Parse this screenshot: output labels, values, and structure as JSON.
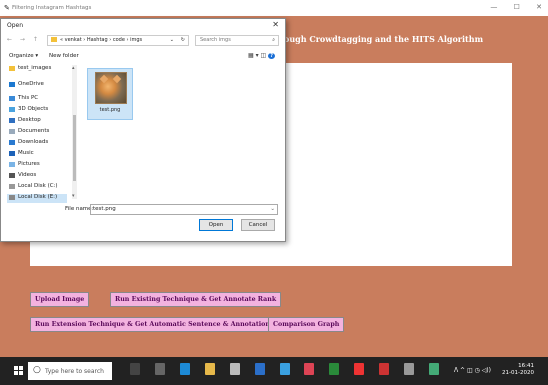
{
  "app": {
    "title": "Filtering Instagram Hashtags",
    "heading": "ough Crowdtagging and the HITS Algorithm",
    "controls": {
      "minimize": "—",
      "maximize": "☐",
      "close": "✕"
    }
  },
  "buttons": {
    "upload": "Upload Image",
    "existing": "Run Existing Technique & Get Annotate Rank",
    "extension": "Run Extension Technique & Get Automatic Sentence & Annotation",
    "comparison": "Comparison Graph"
  },
  "dialog": {
    "title": "Open",
    "close_glyph": "✕",
    "nav_arrows": "← → ↑",
    "path": "« venkat › Hashtag › code › imgs",
    "path_dropdown": "⌄",
    "refresh_glyph": "↻",
    "search_placeholder": "Search imgs",
    "search_glyph": "⌕",
    "toolbar": {
      "organize": "Organize ▾",
      "new_folder": "New folder",
      "view_glyph": "▦ ▾ ◫"
    },
    "help_glyph": "?",
    "sidebar": [
      {
        "label": "test_images",
        "color": "#f3c13a"
      },
      {
        "label": "OneDrive",
        "color": "#1b78d0"
      },
      {
        "label": "This PC",
        "color": "#3a8ad8"
      },
      {
        "label": "3D Objects",
        "color": "#4aa3df"
      },
      {
        "label": "Desktop",
        "color": "#2f6fc0"
      },
      {
        "label": "Documents",
        "color": "#9ab"
      },
      {
        "label": "Downloads",
        "color": "#2a7ad0"
      },
      {
        "label": "Music",
        "color": "#1d62b8"
      },
      {
        "label": "Pictures",
        "color": "#7ab4e6"
      },
      {
        "label": "Videos",
        "color": "#555"
      },
      {
        "label": "Local Disk (C:)",
        "color": "#999"
      },
      {
        "label": "Local Disk (E:)",
        "color": "#888"
      }
    ],
    "scroll_up": "▴",
    "scroll_down": "▾",
    "file": {
      "name": "test.png"
    },
    "file_name_label": "File name:",
    "file_name_value": "test.png",
    "file_name_dropdown": "⌄",
    "open_label": "Open",
    "cancel_label": "Cancel"
  },
  "taskbar": {
    "search_placeholder": "Type here to search",
    "search_glyph": "○",
    "time": "16:41",
    "date": "21-01-2020",
    "tray_glyphs": "ᐱ ^ ◫ ◷ ◁))"
  }
}
